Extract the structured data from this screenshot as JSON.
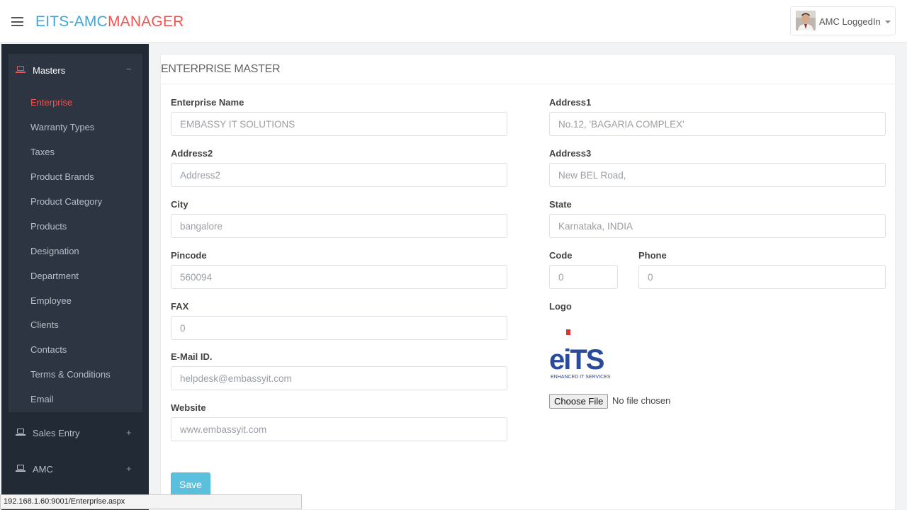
{
  "header": {
    "brand_part1": "EITS-AMC",
    "brand_part2": "MANAGER",
    "user_name": "AMC LoggedIn",
    "colors": {
      "brand_blue": "#3aa7d8",
      "brand_red": "#f0544f"
    }
  },
  "sidebar": {
    "group": {
      "title": "Masters",
      "toggle": "−",
      "icon": "laptop-icon"
    },
    "items": [
      {
        "label": "Enterprise",
        "active": true
      },
      {
        "label": "Warranty Types"
      },
      {
        "label": "Taxes"
      },
      {
        "label": "Product Brands"
      },
      {
        "label": "Product Category"
      },
      {
        "label": "Products"
      },
      {
        "label": "Designation"
      },
      {
        "label": "Department"
      },
      {
        "label": "Employee"
      },
      {
        "label": "Clients"
      },
      {
        "label": "Contacts"
      },
      {
        "label": "Terms & Conditions"
      },
      {
        "label": "Email"
      }
    ],
    "sections": [
      {
        "label": "Sales Entry",
        "toggle": "+",
        "icon": "laptop-icon"
      },
      {
        "label": "AMC",
        "toggle": "+",
        "icon": "laptop-icon"
      }
    ]
  },
  "panel": {
    "title": "ENTERPRISE MASTER",
    "fields": {
      "enterprise_name": {
        "label": "Enterprise Name",
        "value": "EMBASSY IT SOLUTIONS"
      },
      "address1": {
        "label": "Address1",
        "value": "No.12, 'BAGARIA COMPLEX'"
      },
      "address2": {
        "label": "Address2",
        "placeholder": "Address2"
      },
      "address3": {
        "label": "Address3",
        "value": "New BEL Road,"
      },
      "city": {
        "label": "City",
        "value": "bangalore"
      },
      "state": {
        "label": "State",
        "value": "Karnataka, INDIA"
      },
      "pincode": {
        "label": "Pincode",
        "value": "560094"
      },
      "code": {
        "label": "Code",
        "value": "0"
      },
      "phone": {
        "label": "Phone",
        "value": "0"
      },
      "fax": {
        "label": "FAX",
        "value": "0"
      },
      "email": {
        "label": "E-Mail ID.",
        "value": "helpdesk@embassyit.com"
      },
      "website": {
        "label": "Website",
        "value": "www.embassyit.com"
      }
    },
    "logo": {
      "label": "Logo",
      "text": "eiTS",
      "tagline": "ENHANCED IT SERVICES"
    },
    "file_input": {
      "button": "Choose File",
      "status": "No file chosen"
    },
    "save_label": "Save"
  },
  "status_bar": {
    "url": "192.168.1.60:9001/Enterprise.aspx"
  }
}
